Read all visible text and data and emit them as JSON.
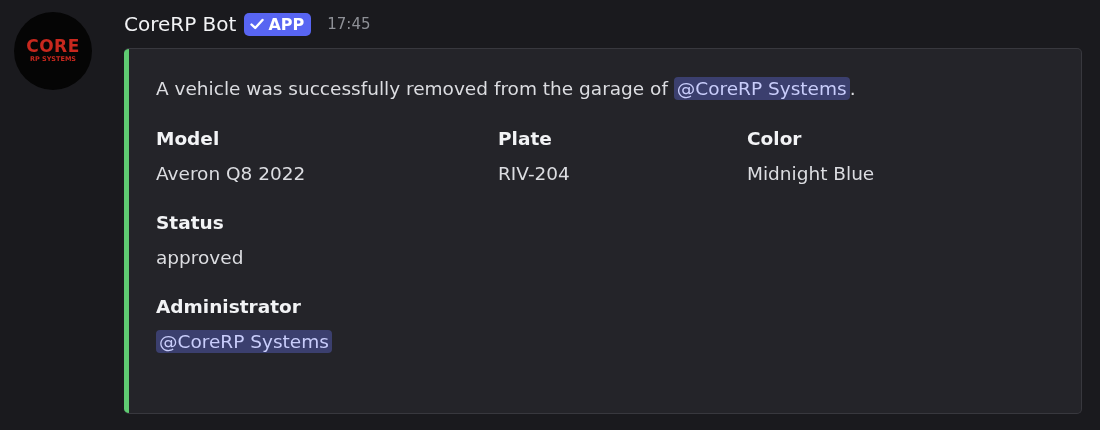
{
  "author": {
    "avatar_lines": [
      "CORE",
      "RP SYSTEMS"
    ],
    "name": "CoreRP Bot",
    "badge": "APP",
    "time": "17:45"
  },
  "embed": {
    "color": "#5fcb72",
    "description": {
      "before": "A vehicle was successfully removed from the garage of ",
      "mention": "@CoreRP Systems",
      "after": "."
    },
    "field_rows": [
      [
        {
          "name": "Model",
          "value": "Averon Q8 2022",
          "kind": "text"
        },
        {
          "name": "Plate",
          "value": "RIV-204",
          "kind": "text"
        },
        {
          "name": "Color",
          "value": "Midnight Blue",
          "kind": "text"
        }
      ],
      [
        {
          "name": "Status",
          "value": "approved",
          "kind": "text"
        }
      ],
      [
        {
          "name": "Administrator",
          "value": "@CoreRP Systems",
          "kind": "mention"
        }
      ]
    ]
  }
}
